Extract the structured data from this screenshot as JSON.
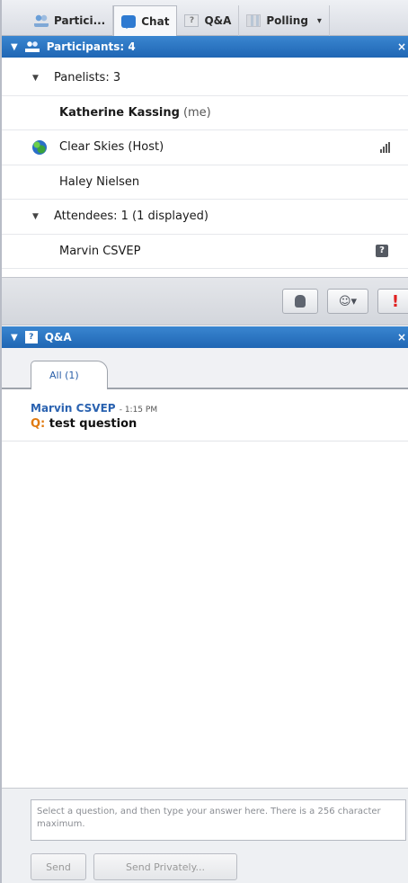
{
  "tabs": [
    {
      "label": "Partici...",
      "icon": "participants-icon"
    },
    {
      "label": "Chat",
      "icon": "chat-icon"
    },
    {
      "label": "Q&A",
      "icon": "qa-icon"
    },
    {
      "label": "Polling",
      "icon": "polling-icon"
    }
  ],
  "tab_menu_glyph": "▾",
  "participants": {
    "header": "Participants: 4",
    "panelists_label": "Panelists: 3",
    "panelists": [
      {
        "name": "Katherine Kassing",
        "suffix": "(me)"
      },
      {
        "name": "Clear Skies (Host)"
      },
      {
        "name": "Haley Nielsen"
      }
    ],
    "attendees_label": "Attendees: 1 (1 displayed)",
    "attendees": [
      {
        "name": "Marvin CSVEP",
        "badge": "?"
      }
    ]
  },
  "toolbar": {
    "emoticon_label": "☺▾",
    "alert_label": "!"
  },
  "qa": {
    "header": "Q&A",
    "filter_tab": "All (1)",
    "questions": [
      {
        "author": "Marvin CSVEP",
        "time": "- 1:15 PM",
        "prefix": "Q:",
        "text": "test question"
      }
    ],
    "answer_placeholder": "Select a question, and then type your answer here. There is a 256 character maximum.",
    "send_label": "Send",
    "send_privately_label": "Send Privately..."
  },
  "colors": {
    "header_blue": "#1f66b4",
    "author_blue": "#2a62b0",
    "question_prefix_orange": "#e07a10",
    "alert_red": "#e02020"
  }
}
